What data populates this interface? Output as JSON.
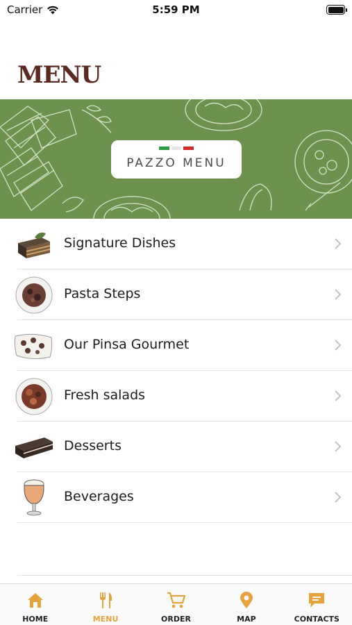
{
  "status_bar": {
    "carrier": "Carrier",
    "time": "5:59 PM"
  },
  "header": {
    "title": "MENU"
  },
  "banner": {
    "label": "PAZZO MENU",
    "flag_colors": [
      "#2e9a44",
      "#e6e6e6",
      "#cf2b2b"
    ],
    "background": "#6e9150"
  },
  "menu": {
    "items": [
      {
        "label": "Signature Dishes",
        "icon": "lasagna-thumbnail"
      },
      {
        "label": "Pasta Steps",
        "icon": "pasta-plate-thumbnail"
      },
      {
        "label": "Our Pinsa Gourmet",
        "icon": "pinsa-thumbnail"
      },
      {
        "label": "Fresh salads",
        "icon": "salad-plate-thumbnail"
      },
      {
        "label": "Desserts",
        "icon": "dessert-slice-thumbnail"
      },
      {
        "label": "Beverages",
        "icon": "beer-glass-thumbnail"
      }
    ]
  },
  "tab_bar": {
    "accent": "#e6a33c",
    "tabs": [
      {
        "label": "HOME",
        "icon": "home-icon",
        "active": false
      },
      {
        "label": "MENU",
        "icon": "fork-knife-icon",
        "active": true
      },
      {
        "label": "ORDER",
        "icon": "cart-icon",
        "active": false
      },
      {
        "label": "MAP",
        "icon": "map-pin-icon",
        "active": false
      },
      {
        "label": "CONTACTS",
        "icon": "chat-bubble-icon",
        "active": false
      }
    ]
  }
}
